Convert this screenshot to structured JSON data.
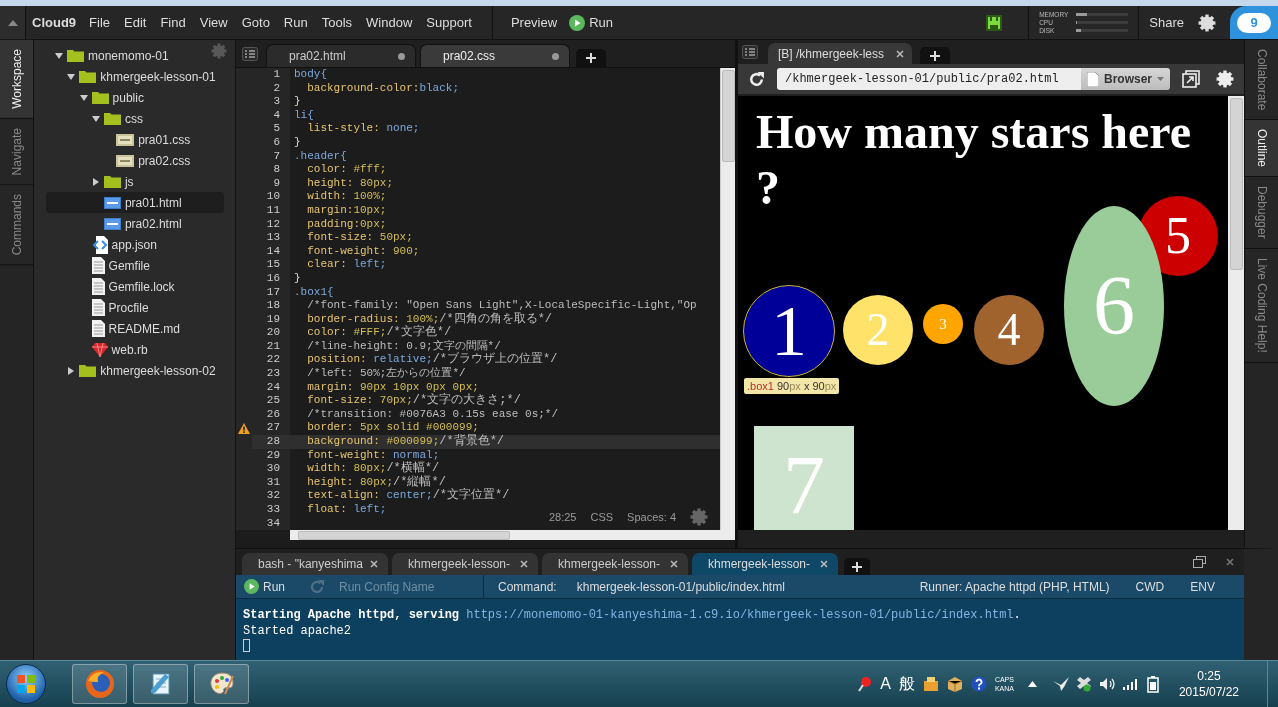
{
  "menubar": {
    "brand": "Cloud9",
    "menus": [
      "File",
      "Edit",
      "Find",
      "View",
      "Goto",
      "Run",
      "Tools",
      "Window",
      "Support"
    ],
    "preview": "Preview",
    "run": "Run",
    "meters": [
      {
        "label": "MEMORY",
        "level": 0.2
      },
      {
        "label": "CPU",
        "level": 0.02
      },
      {
        "label": "DISK",
        "level": 0.1
      }
    ],
    "share": "Share",
    "logo": "9"
  },
  "left_tabs": [
    {
      "label": "Workspace",
      "selected": true
    },
    {
      "label": "Navigate",
      "selected": false
    },
    {
      "label": "Commands",
      "selected": false
    }
  ],
  "tree": [
    {
      "name": "monemomo-01",
      "kind": "folder",
      "expanded": true,
      "selected": false,
      "children": [
        {
          "name": "khmergeek-lesson-01",
          "kind": "folder",
          "expanded": true,
          "selected": false,
          "children": [
            {
              "name": "public",
              "kind": "folder",
              "expanded": true,
              "selected": false,
              "children": [
                {
                  "name": "css",
                  "kind": "folder",
                  "expanded": true,
                  "selected": false,
                  "children": [
                    {
                      "name": "pra01.css",
                      "kind": "css",
                      "selected": false
                    },
                    {
                      "name": "pra02.css",
                      "kind": "css",
                      "selected": false
                    }
                  ]
                },
                {
                  "name": "js",
                  "kind": "folder",
                  "expanded": false,
                  "selected": false
                },
                {
                  "name": "pra01.html",
                  "kind": "html",
                  "selected": true
                },
                {
                  "name": "pra02.html",
                  "kind": "html",
                  "selected": false
                }
              ]
            },
            {
              "name": "app.json",
              "kind": "json",
              "selected": false
            },
            {
              "name": "Gemfile",
              "kind": "text",
              "selected": false
            },
            {
              "name": "Gemfile.lock",
              "kind": "text",
              "selected": false
            },
            {
              "name": "Procfile",
              "kind": "text",
              "selected": false
            },
            {
              "name": "README.md",
              "kind": "text",
              "selected": false
            },
            {
              "name": "web.rb",
              "kind": "ruby",
              "selected": false
            }
          ]
        },
        {
          "name": "khmergeek-lesson-02",
          "kind": "folder",
          "expanded": false,
          "selected": false
        }
      ]
    }
  ],
  "editor": {
    "tabs": [
      {
        "label": "pra02.html",
        "selected": false
      },
      {
        "label": "pra02.css",
        "selected": true
      }
    ],
    "lines": [
      {
        "n": "1",
        "kind": "selector",
        "text": "body{",
        "current": false,
        "warning": false
      },
      {
        "n": "2",
        "kind": "decl",
        "text": "  background-color:black;",
        "current": false,
        "warning": false
      },
      {
        "n": "3",
        "kind": "brace",
        "text": "}",
        "current": false,
        "warning": false
      },
      {
        "n": "4",
        "kind": "selector",
        "text": "li{",
        "current": false,
        "warning": false
      },
      {
        "n": "5",
        "kind": "decl",
        "text": "  list-style: none;",
        "current": false,
        "warning": false
      },
      {
        "n": "6",
        "kind": "brace",
        "text": "}",
        "current": false,
        "warning": false
      },
      {
        "n": "7",
        "kind": "selector",
        "text": ".header{",
        "current": false,
        "warning": false
      },
      {
        "n": "8",
        "kind": "decl",
        "text": "  color: #fff;",
        "current": false,
        "warning": false
      },
      {
        "n": "9",
        "kind": "decl",
        "text": "  height: 80px;",
        "current": false,
        "warning": false
      },
      {
        "n": "10",
        "kind": "decl",
        "text": "  width: 100%;",
        "current": false,
        "warning": false
      },
      {
        "n": "11",
        "kind": "decl",
        "text": "  margin:10px;",
        "current": false,
        "warning": false
      },
      {
        "n": "12",
        "kind": "decl",
        "text": "  padding:0px;",
        "current": false,
        "warning": false
      },
      {
        "n": "13",
        "kind": "decl",
        "text": "  font-size: 50px;",
        "current": false,
        "warning": false
      },
      {
        "n": "14",
        "kind": "decl",
        "text": "  font-weight: 900;",
        "current": false,
        "warning": false
      },
      {
        "n": "15",
        "kind": "decl",
        "text": "  clear: left;",
        "current": false,
        "warning": false
      },
      {
        "n": "16",
        "kind": "brace",
        "text": "}",
        "current": false,
        "warning": false
      },
      {
        "n": "17",
        "kind": "selector",
        "text": ".box1{",
        "current": false,
        "warning": false
      },
      {
        "n": "18",
        "kind": "comment",
        "text": "  /*font-family: \"Open Sans Light\",X-LocaleSpecific-Light,\"Op",
        "current": false,
        "warning": false
      },
      {
        "n": "19",
        "kind": "decl",
        "text": "  border-radius: 100%;/*四角の角を取る*/",
        "current": false,
        "warning": false
      },
      {
        "n": "20",
        "kind": "decl",
        "text": "  color: #FFF;/*文字色*/",
        "current": false,
        "warning": false
      },
      {
        "n": "21",
        "kind": "comment",
        "text": "  /*line-height: 0.9;文字の間隔*/",
        "current": false,
        "warning": false
      },
      {
        "n": "22",
        "kind": "decl",
        "text": "  position: relative;/*ブラウザ上の位置*/",
        "current": false,
        "warning": false
      },
      {
        "n": "23",
        "kind": "comment",
        "text": "  /*left: 50%;左からの位置*/",
        "current": false,
        "warning": false
      },
      {
        "n": "24",
        "kind": "decl",
        "text": "  margin: 90px 10px 0px 0px;",
        "current": false,
        "warning": false
      },
      {
        "n": "25",
        "kind": "decl",
        "text": "  font-size: 70px;/*文字の大きさ;*/",
        "current": false,
        "warning": false
      },
      {
        "n": "26",
        "kind": "comment",
        "text": "  /*transition: #0076A3 0.15s ease 0s;*/",
        "current": false,
        "warning": false
      },
      {
        "n": "27",
        "kind": "decl",
        "text": "  border: 5px solid #000099;",
        "current": false,
        "warning": true
      },
      {
        "n": "28",
        "kind": "decl",
        "text": "  background: #000099;/*背景色*/",
        "current": true,
        "warning": false
      },
      {
        "n": "29",
        "kind": "decl",
        "text": "  font-weight: normal;",
        "current": false,
        "warning": false
      },
      {
        "n": "30",
        "kind": "decl",
        "text": "  width: 80px;/*横幅*/",
        "current": false,
        "warning": false
      },
      {
        "n": "31",
        "kind": "decl",
        "text": "  height: 80px;/*縦幅*/",
        "current": false,
        "warning": false
      },
      {
        "n": "32",
        "kind": "decl",
        "text": "  text-align: center;/*文字位置*/",
        "current": false,
        "warning": false
      },
      {
        "n": "33",
        "kind": "decl",
        "text": "  float: left;",
        "current": false,
        "warning": false
      },
      {
        "n": "34",
        "kind": "blank",
        "current": false,
        "warning": false
      }
    ],
    "status": {
      "position": "28:25",
      "mode": "CSS",
      "indent": "Spaces: 4"
    }
  },
  "preview": {
    "tabs": [
      {
        "label": "[B] /khmergeek-less",
        "selected": true
      }
    ],
    "url": "/khmergeek-lesson-01/public/pra02.html",
    "browser": "Browser",
    "heading": "How many stars here ?",
    "shapes": [
      {
        "label": "1",
        "kind": "circle",
        "color": "#000099",
        "highlighted": true
      },
      {
        "label": "2",
        "kind": "circle",
        "color": "#ffe26a",
        "highlighted": false
      },
      {
        "label": "3",
        "kind": "circle",
        "color": "#ffa500",
        "highlighted": false
      },
      {
        "label": "4",
        "kind": "circle",
        "color": "#a0632e",
        "highlighted": false
      },
      {
        "label": "5",
        "kind": "circle",
        "color": "#cc0000",
        "highlighted": false
      },
      {
        "label": "6",
        "kind": "ellipse",
        "color": "#99cc99",
        "highlighted": false
      },
      {
        "label": "7",
        "kind": "square",
        "color": "#cfe4cf",
        "highlighted": false
      }
    ],
    "tooltip": [
      {
        "text": ".box1 ",
        "kind": "selector"
      },
      {
        "text": "90",
        "kind": "value"
      },
      {
        "text": "px",
        "kind": "unit"
      },
      {
        "text": " x ",
        "kind": "value"
      },
      {
        "text": "90",
        "kind": "value"
      },
      {
        "text": "px",
        "kind": "unit"
      }
    ]
  },
  "right_tabs": [
    {
      "label": "Collaborate",
      "selected": false
    },
    {
      "label": "Outline",
      "selected": true
    },
    {
      "label": "Debugger",
      "selected": false
    },
    {
      "label": "Live Coding Help!",
      "selected": false
    }
  ],
  "console": {
    "tabs": [
      {
        "label": "bash - \"kanyeshima",
        "selected": false
      },
      {
        "label": "khmergeek-lesson-",
        "selected": false
      },
      {
        "label": "khmergeek-lesson-",
        "selected": false
      },
      {
        "label": "khmergeek-lesson-",
        "selected": true
      }
    ],
    "run": "Run",
    "restart": {
      "disabled": true
    },
    "config_placeholder": "Run Config Name",
    "command_label": "Command:",
    "command": "khmergeek-lesson-01/public/index.html",
    "runner": "Runner: Apache httpd (PHP, HTML)",
    "cwd": "CWD",
    "env": "ENV",
    "output": [
      {
        "kind": "serving",
        "text": "**Starting Apache httpd, serving** ",
        "link": "https://monemomo-01-kanyeshima-1.c9.io/khmergeek-lesson-01/public/index.html",
        "after": "."
      },
      {
        "kind": "plain",
        "text": "Started apache2"
      }
    ]
  },
  "taskbar": {
    "ime": "A",
    "ime_mode": "般",
    "caps": "CAPS",
    "kana": "KANA",
    "time": "0:25",
    "date": "2015/07/22"
  }
}
